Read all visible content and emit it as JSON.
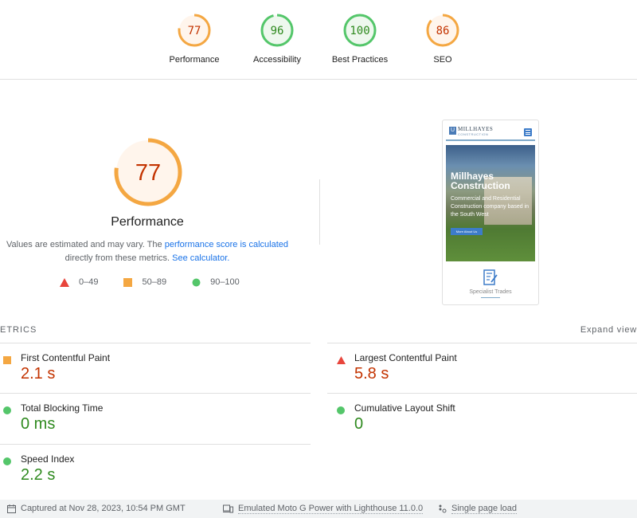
{
  "colors": {
    "fail": "#e8453c",
    "average": "#f4a742",
    "pass": "#54c66a",
    "fail_text": "#c33300",
    "average_text": "#c33300",
    "pass_text": "#2f8a1f",
    "link": "#1a73e8"
  },
  "categories": [
    {
      "label": "Performance",
      "score": 77,
      "rating": "average"
    },
    {
      "label": "Accessibility",
      "score": 96,
      "rating": "pass"
    },
    {
      "label": "Best Practices",
      "score": 100,
      "rating": "pass"
    },
    {
      "label": "SEO",
      "score": 86,
      "rating": "average"
    }
  ],
  "performance": {
    "score": 77,
    "title": "Performance",
    "description_prefix": "Values are estimated and may vary. The ",
    "description_link": "performance score is calculated",
    "description_middle": "directly from these metrics. ",
    "calculator_link": "See calculator.",
    "legend": [
      {
        "icon": "triangle-icon",
        "range": "0–49"
      },
      {
        "icon": "square-icon",
        "range": "50–89"
      },
      {
        "icon": "circle-icon",
        "range": "90–100"
      }
    ]
  },
  "screenshot": {
    "logo_text": "MILLHAYES",
    "logo_sub": "CONSTRUCTION",
    "logo_box": "U",
    "hero_title_1": "Millhayes",
    "hero_title_2": "Construction",
    "hero_subtitle": "Commercial and Residential Construction company based in the South West",
    "hero_button": "More About Us",
    "trade_label": "Specialist Trades"
  },
  "metrics": {
    "heading": "ETRICS",
    "expand_label": "Expand view",
    "items": [
      {
        "name": "First Contentful Paint",
        "value": "2.1 s",
        "rating": "average"
      },
      {
        "name": "Largest Contentful Paint",
        "value": "5.8 s",
        "rating": "fail"
      },
      {
        "name": "Total Blocking Time",
        "value": "0 ms",
        "rating": "pass"
      },
      {
        "name": "Cumulative Layout Shift",
        "value": "0",
        "rating": "pass"
      },
      {
        "name": "Speed Index",
        "value": "2.2 s",
        "rating": "pass"
      }
    ]
  },
  "footer": {
    "captured": "Captured at Nov 28, 2023, 10:54 PM GMT",
    "emulated": "Emulated Moto G Power with Lighthouse 11.0.0",
    "load": "Single page load"
  }
}
